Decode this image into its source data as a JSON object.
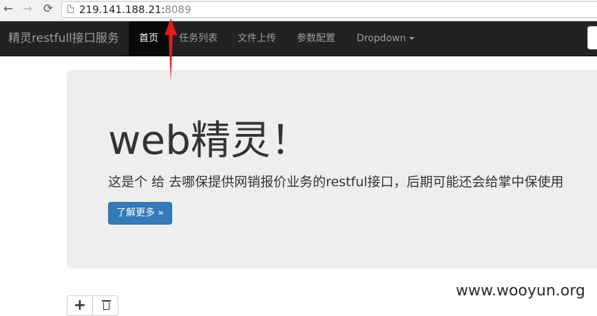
{
  "browser": {
    "url_host": "219.141.188.21:",
    "url_port": "8089",
    "back_icon": "←",
    "forward_icon": "→",
    "reload_icon": "⟳"
  },
  "navbar": {
    "brand": "精灵restfull接口服务",
    "items": [
      {
        "label": "首页",
        "active": true
      },
      {
        "label": "任务列表"
      },
      {
        "label": "文件上传"
      },
      {
        "label": "参数配置"
      },
      {
        "label": "Dropdown"
      }
    ]
  },
  "jumbotron": {
    "title": "web精灵！",
    "lead": "这是个 给 去哪保提供网销报价业务的restful接口，后期可能还会给掌中保使用",
    "button_label": "了解更多 »"
  },
  "toolbar": {
    "add_label": "+"
  },
  "watermark": "www.wooyun.org",
  "colors": {
    "navbar_bg": "#222222",
    "active_bg": "#080808",
    "primary": "#337ab7",
    "jumbotron_bg": "#eeeeee",
    "arrow": "#e41b1b"
  }
}
